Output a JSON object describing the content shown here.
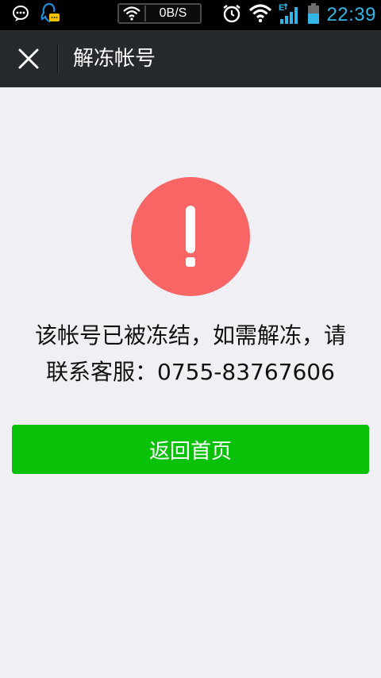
{
  "status_bar": {
    "net_speed": "0B/S",
    "clock": "22:39",
    "network_type": "E",
    "icons": [
      "chat-bubble-icon",
      "qq-notification-icon",
      "wifi-icon",
      "alarm-icon",
      "wifi-signal-icon",
      "cellular-signal-icon",
      "battery-icon"
    ]
  },
  "header": {
    "title": "解冻帐号",
    "close_icon": "close-icon"
  },
  "alert": {
    "icon": "exclamation-icon",
    "color": "#f76565",
    "message_line1": "该帐号已被冻结，如需解冻，请",
    "message_line2": "联系客服：0755-83767606"
  },
  "actions": {
    "home_button_label": "返回首页",
    "home_button_color": "#09c109"
  }
}
